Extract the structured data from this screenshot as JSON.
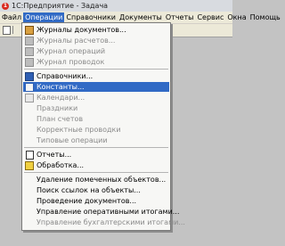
{
  "window": {
    "title": "1С:Предприятие - Задача"
  },
  "menubar": {
    "items": [
      "Файл",
      "Операции",
      "Справочники",
      "Документы",
      "Отчеты",
      "Сервис",
      "Окна",
      "Помощь"
    ]
  },
  "dropdown": {
    "items": [
      {
        "label": "Журналы документов...",
        "icon": "journal-icon",
        "disabled": false,
        "highlighted": false
      },
      {
        "label": "Журналы расчетов...",
        "icon": "journal-icon",
        "disabled": true,
        "highlighted": false
      },
      {
        "label": "Журнал операций",
        "icon": "journal-icon",
        "disabled": true,
        "highlighted": false
      },
      {
        "label": "Журнал проводок",
        "icon": "journal-icon",
        "disabled": true,
        "highlighted": false
      },
      {
        "label": "Справочники...",
        "icon": "catalog-icon",
        "disabled": false,
        "highlighted": false
      },
      {
        "label": "Константы...",
        "icon": "constants-icon",
        "disabled": false,
        "highlighted": true
      },
      {
        "label": "Календари...",
        "icon": "calendar-icon",
        "disabled": true,
        "highlighted": false
      },
      {
        "label": "Праздники",
        "icon": "",
        "disabled": true,
        "highlighted": false
      },
      {
        "label": "План счетов",
        "icon": "",
        "disabled": true,
        "highlighted": false
      },
      {
        "label": "Корректные проводки",
        "icon": "",
        "disabled": true,
        "highlighted": false
      },
      {
        "label": "Типовые операции",
        "icon": "",
        "disabled": true,
        "highlighted": false
      },
      {
        "label": "Отчеты...",
        "icon": "report-icon",
        "disabled": false,
        "highlighted": false
      },
      {
        "label": "Обработка...",
        "icon": "processing-icon",
        "disabled": false,
        "highlighted": false
      },
      {
        "label": "Удаление помеченных объектов...",
        "icon": "",
        "disabled": false,
        "highlighted": false
      },
      {
        "label": "Поиск ссылок на объекты...",
        "icon": "",
        "disabled": false,
        "highlighted": false
      },
      {
        "label": "Проведение документов...",
        "icon": "",
        "disabled": false,
        "highlighted": false
      },
      {
        "label": "Управление оперативными итогами...",
        "icon": "",
        "disabled": false,
        "highlighted": false
      },
      {
        "label": "Управление бухгалтерскими итогами...",
        "icon": "",
        "disabled": true,
        "highlighted": false
      }
    ]
  },
  "colors": {
    "highlight": "#316ac5",
    "disabled_text": "#8a8a8a",
    "menu_bg": "#f7f7f5"
  }
}
